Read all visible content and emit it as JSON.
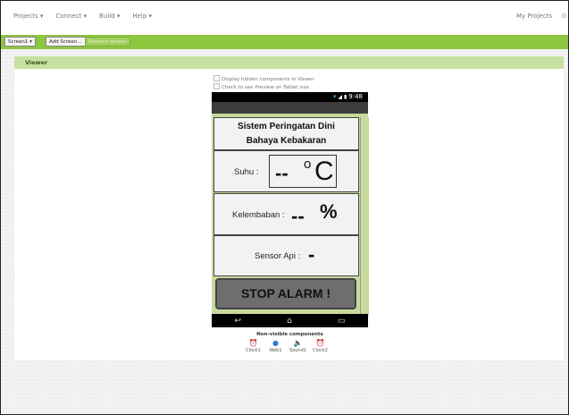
{
  "menu": {
    "items": [
      "Projects ▾",
      "Connect ▾",
      "Build ▾",
      "Help ▾"
    ],
    "my_projects": "My Projects",
    "tail": "G"
  },
  "toolbar": {
    "screen_select": "Screen1 ▾",
    "add_screen": "Add Screen...",
    "remove_screen": "Remove Screen"
  },
  "viewer": {
    "title": "Viewer",
    "checkbox_hidden": "Display hidden components in Viewer",
    "checkbox_tablet": "Check to see Preview on Tablet size."
  },
  "phone": {
    "time": "9:48",
    "app_title_line1": "Sistem Peringatan Dini",
    "app_title_line2": "Bahaya Kebakaran",
    "suhu_label": "Suhu :",
    "suhu_value": "--",
    "degree": "o",
    "celsius": "C",
    "kelembaban_label": "Kelembaban :",
    "kelembaban_value": "--",
    "percent": "%",
    "sensor_label": "Sensor Api :",
    "sensor_value": "-",
    "stop_button": "STOP ALARM !",
    "nav_back": "↩",
    "nav_home": "⌂",
    "nav_recent": "▭"
  },
  "nonvisible": {
    "title": "Non-visible components",
    "items": [
      {
        "icon": "clock-icon",
        "glyph": "⏰",
        "label": "Clock1"
      },
      {
        "icon": "web-icon",
        "glyph": "●",
        "label": "Web1"
      },
      {
        "icon": "sound-icon",
        "glyph": "🔈",
        "label": "Sound1"
      },
      {
        "icon": "clock-icon",
        "glyph": "⏰",
        "label": "Clock2"
      }
    ]
  },
  "colors": {
    "toolbar_green": "#8dc63f",
    "viewer_header": "#c8e0a0",
    "phone_bg": "#c8d99c"
  }
}
